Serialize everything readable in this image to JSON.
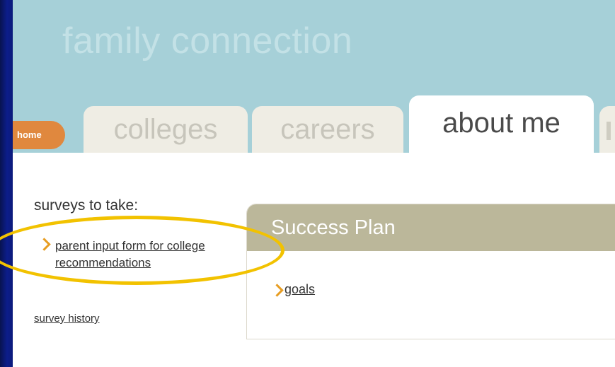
{
  "site": {
    "title": "family connection"
  },
  "nav": {
    "home": "home",
    "tabs": [
      {
        "label": "colleges",
        "active": false
      },
      {
        "label": "careers",
        "active": false
      },
      {
        "label": "about me",
        "active": true
      }
    ]
  },
  "sidebar": {
    "heading": "surveys to take:",
    "survey_link": "parent input form for college recommendations",
    "history_link": "survey history"
  },
  "panel": {
    "title": "Success Plan",
    "links": [
      "goals"
    ]
  },
  "annotation": {
    "color": "#f2c200",
    "shape": "ellipse"
  },
  "colors": {
    "header": "#a6d0d8",
    "home_tab": "#e0883e",
    "panel_header": "#bbb79a",
    "chevron": "#e79d22",
    "slide_background": "#0b1a78"
  }
}
